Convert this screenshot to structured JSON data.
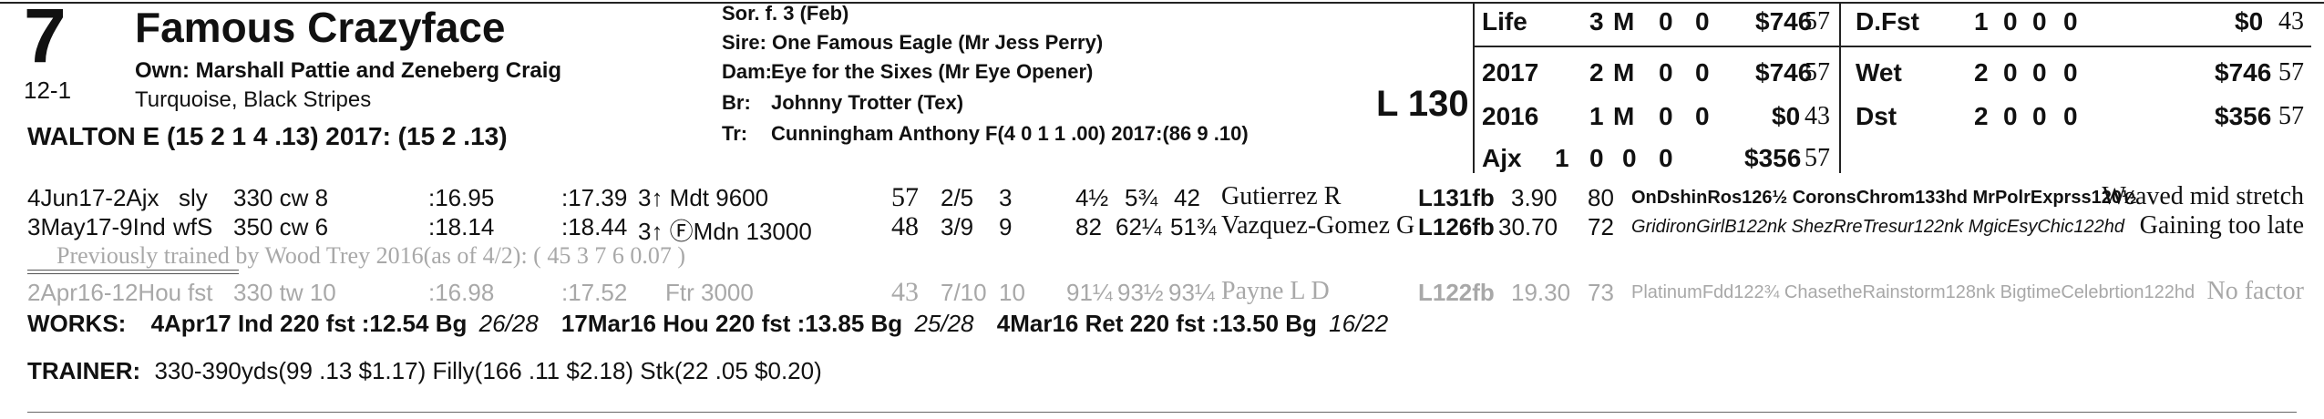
{
  "horse": {
    "number": "7",
    "name": "Famous Crazyface",
    "odds": "12-1",
    "owner": "Own: Marshall Pattie and Zeneberg Craig",
    "silks": "Turquoise, Black Stripes",
    "jockey": "WALTON E (15 2 1 4 .13) 2017: (15 2 .13)"
  },
  "pedigree": {
    "sex_age": "Sor. f. 3 (Feb)",
    "sire": "Sire: One Famous Eagle (Mr Jess Perry)",
    "dam_label": "Dam:",
    "dam": "Eye for the Sixes (Mr Eye Opener)",
    "br_label": "Br:",
    "breeder": "Johnny Trotter (Tex)",
    "tr_label": "Tr:",
    "trainer": "Cunningham Anthony F(4 0 1 1 .00)  2017:(86 9 .10)"
  },
  "weight": "L 130",
  "stats_left": [
    {
      "label": "Life",
      "st": "3",
      "w": "M",
      "p": "0",
      "s": "0",
      "earn": "$746",
      "spd": "57"
    },
    {
      "label": "2017",
      "st": "2",
      "w": "M",
      "p": "0",
      "s": "0",
      "earn": "$746",
      "spd": "57"
    },
    {
      "label": "2016",
      "st": "1",
      "w": "M",
      "p": "0",
      "s": "0",
      "earn": "$0",
      "spd": "43"
    },
    {
      "label": "Ajx",
      "st": "1",
      "w": "0",
      "p": "0",
      "s": "0",
      "earn": "$356",
      "spd": "57"
    }
  ],
  "stats_right": [
    {
      "label": "D.Fst",
      "st": "1",
      "w": "0",
      "p": "0",
      "s": "0",
      "earn": "$0",
      "spd": "43"
    },
    {
      "label": "Wet",
      "st": "2",
      "w": "0",
      "p": "0",
      "s": "0",
      "earn": "$746",
      "spd": "57"
    },
    {
      "label": "Dst",
      "st": "2",
      "w": "0",
      "p": "0",
      "s": "0",
      "earn": "$356",
      "spd": "57"
    }
  ],
  "races": [
    {
      "date": "4Jun17-2Ajx",
      "cond": "sly",
      "dist": "330 cw 8",
      "f1": ":16.95",
      "f2": ":17.39",
      "race": "3↑ Mdt 9600",
      "spd": "57",
      "pp": "2/5",
      "st": "3",
      "c1": "4½",
      "c2": "5¾",
      "c3": "42",
      "jockey": "Gutierrez R",
      "wt": "L131fb",
      "odds": "3.90",
      "fig": "80",
      "comp": "OnDshinRos126½ CoronsChrom133hd MrPolrExprss120½",
      "comment": "Weaved mid stretch"
    },
    {
      "date": "3May17-9Ind",
      "cond": "wfS",
      "dist": "350 cw 6",
      "f1": ":18.14",
      "f2": ":18.44",
      "race": "3↑ ⒻMdn 13000",
      "spd": "48",
      "pp": "3/9",
      "st": "9",
      "c1": "82",
      "c2": "62¼",
      "c3": "51¾",
      "jockey": "Vazquez-Gomez G",
      "wt": "L126fb",
      "odds": "30.70",
      "fig": "72",
      "comp": "GridironGirlB122nk ShezRreTresur122nk MgicEsyChic122hd",
      "comment": "Gaining too late"
    },
    {
      "date": "2Apr16-12Hou",
      "cond": "fst",
      "dist": "330 tw 10",
      "f1": ":16.98",
      "f2": ":17.52",
      "race": "Ftr 3000",
      "spd": "43",
      "pp": "7/10",
      "st": "10",
      "c1": "91¼",
      "c2": "93½",
      "c3": "93¼",
      "jockey": "Payne L D",
      "wt": "L122fb",
      "odds": "19.30",
      "fig": "73",
      "comp": "PlatinumFdd122¾ ChasetheRainstorm128nk BigtimeCelebrtion122hd",
      "comment": "No factor"
    }
  ],
  "prev_trained": "Previously trained by Wood Trey 2016(as of 4/2): ( 45 3 7 6 0.07 )",
  "works": {
    "label": "WORKS:",
    "w1": "4Apr17 Ind 220 fst :12.54 Bg",
    "r1": "26/28",
    "w2": "17Mar16 Hou 220 fst :13.85 Bg",
    "r2": "25/28",
    "w3": "4Mar16 Ret 220 fst :13.50 Bg",
    "r3": "16/22"
  },
  "trainer_stats": {
    "label": "TRAINER:",
    "text": "330-390yds(99 .13 $1.17) Filly(166 .11 $2.18) Stk(22 .05 $0.20)"
  }
}
